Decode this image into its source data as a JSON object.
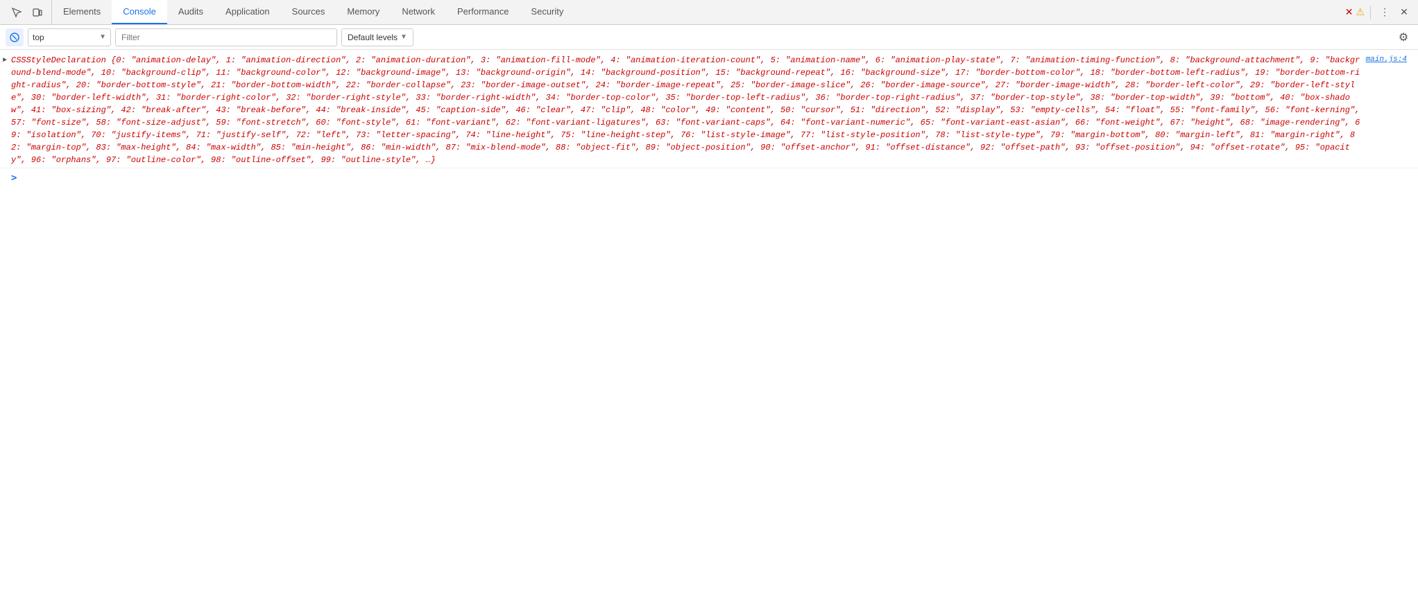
{
  "tabs": {
    "items": [
      {
        "label": "Elements",
        "active": false
      },
      {
        "label": "Console",
        "active": true
      },
      {
        "label": "Audits",
        "active": false
      },
      {
        "label": "Application",
        "active": false
      },
      {
        "label": "Sources",
        "active": false
      },
      {
        "label": "Memory",
        "active": false
      },
      {
        "label": "Network",
        "active": false
      },
      {
        "label": "Performance",
        "active": false
      },
      {
        "label": "Security",
        "active": false
      }
    ]
  },
  "toolbar": {
    "context_label": "top",
    "filter_placeholder": "Filter",
    "levels_label": "Default levels",
    "gear_label": "Settings"
  },
  "console": {
    "source_link": "main.js:4",
    "entry_text": "CSSStyleDeclaration {0: \"animation-delay\", 1: \"animation-direction\", 2: \"animation-duration\", 3: \"animation-fill-mode\", 4: \"animation-iteration-count\", 5: \"animation-name\", 6: \"animation-play-state\", 7: \"animation-timing-function\", 8: \"background-attachment\", 9: \"background-blend-mode\", 10: \"background-clip\", 11: \"background-color\", 12: \"background-image\", 13: \"background-origin\", 14: \"background-position\", 15: \"background-repeat\", 16: \"background-size\", 17: \"border-bottom-color\", 18: \"border-bottom-left-radius\", 19: \"border-bottom-right-radius\", 20: \"border-bottom-style\", 21: \"border-bottom-width\", 22: \"border-collapse\", 23: \"border-image-outset\", 24: \"border-image-repeat\", 25: \"border-image-slice\", 26: \"border-image-source\", 27: \"border-image-width\", 28: \"border-left-color\", 29: \"border-left-style\", 30: \"border-left-width\", 31: \"border-right-color\", 32: \"border-right-style\", 33: \"border-right-width\", 34: \"border-top-color\", 35: \"border-top-left-radius\", 36: \"border-top-right-radius\", 37: \"border-top-style\", 38: \"border-top-width\", 39: \"bottom\", 40: \"box-shadow\", 41: \"box-sizing\", 42: \"break-after\", 43: \"break-before\", 44: \"break-inside\", 45: \"caption-side\", 46: \"clear\", 47: \"clip\", 48: \"color\", 49: \"content\", 50: \"cursor\", 51: \"direction\", 52: \"display\", 53: \"empty-cells\", 54: \"float\", 55: \"font-family\", 56: \"font-kerning\", 57: \"font-size\", 58: \"font-size-adjust\", 59: \"font-stretch\", 60: \"font-style\", 61: \"font-variant\", 62: \"font-variant-ligatures\", 63: \"font-variant-caps\", 64: \"font-variant-numeric\", 65: \"font-variant-east-asian\", 66: \"font-weight\", 67: \"height\", 68: \"image-rendering\", 69: \"isolation\", 70: \"justify-items\", 71: \"justify-self\", 72: \"left\", 73: \"letter-spacing\", 74: \"line-height\", 75: \"line-height-step\", 76: \"list-style-image\", 77: \"list-style-position\", 78: \"list-style-type\", 79: \"margin-bottom\", 80: \"margin-left\", 81: \"margin-right\", 82: \"margin-top\", 83: \"max-height\", 84: \"max-width\", 85: \"min-height\", 86: \"min-width\", 87: \"mix-blend-mode\", 88: \"object-fit\", 89: \"object-position\", 90: \"offset-anchor\", 91: \"offset-distance\", 92: \"offset-path\", 93: \"offset-position\", 94: \"offset-rotate\", 95: \"opacity\", 96: \"orphans\", 97: \"outline-color\", 98: \"outline-offset\", 99: \"outline-style\", …}"
  }
}
